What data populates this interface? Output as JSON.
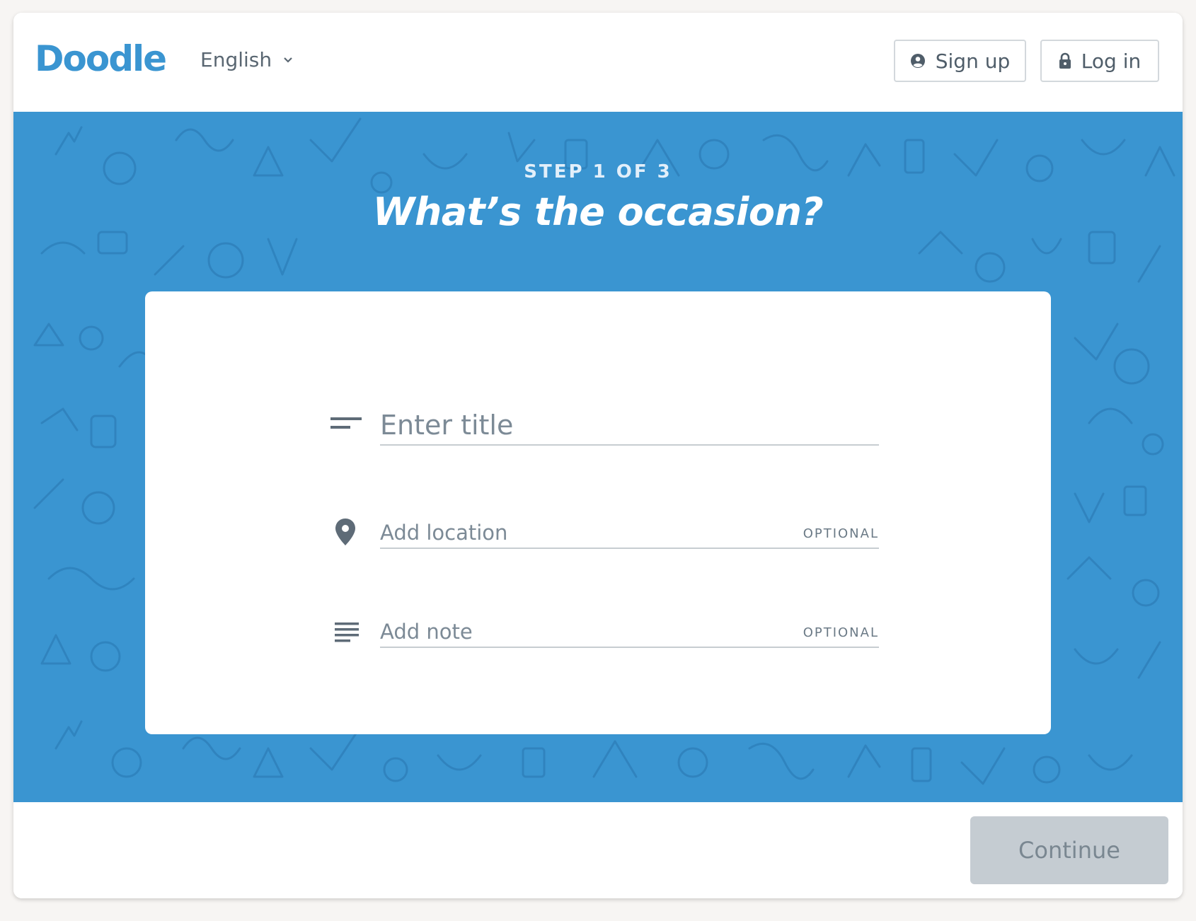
{
  "header": {
    "logo": "Doodle",
    "language": "English",
    "signup_label": "Sign up",
    "login_label": "Log in"
  },
  "hero": {
    "step": "STEP 1 OF 3",
    "title": "What’s the occasion?"
  },
  "form": {
    "title_placeholder": "Enter title",
    "location_placeholder": "Add location",
    "location_optional": "OPTIONAL",
    "note_placeholder": "Add note",
    "note_optional": "OPTIONAL"
  },
  "footer": {
    "continue_label": "Continue"
  },
  "colors": {
    "brand": "#3a95d1",
    "button_disabled": "#c5ccd2",
    "text_muted": "#7c8a96"
  },
  "icons": {
    "language": "chevron-down-icon",
    "signup": "user-circle-icon",
    "login": "lock-icon",
    "title": "title-lines-icon",
    "location": "map-pin-icon",
    "note": "note-lines-icon"
  }
}
